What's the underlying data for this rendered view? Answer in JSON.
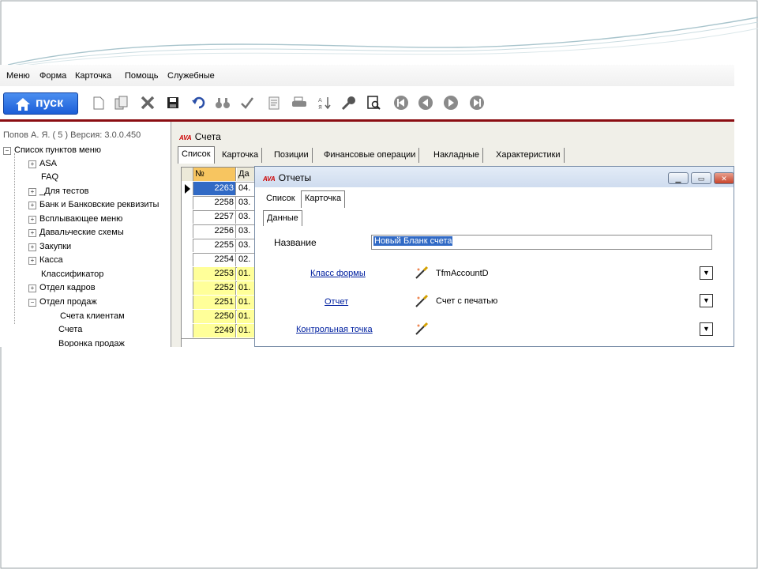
{
  "menu": [
    "Меню",
    "Форма",
    "Карточка",
    "Помощь",
    "Служебные"
  ],
  "toolbar": {
    "start_label": "пуск",
    "icons": [
      "new-doc-icon",
      "copy-doc-icon",
      "delete-icon",
      "save-icon",
      "undo-icon",
      "find-icon",
      "check-icon",
      "edit-icon",
      "print-icon",
      "sort-icon",
      "key-icon",
      "preview-icon",
      "first-record-icon",
      "prev-record-icon",
      "next-record-icon",
      "last-record-icon"
    ]
  },
  "status": {
    "user": "Попов А. Я. ( 5 )",
    "version": "Версия: 3.0.0.450"
  },
  "tree": {
    "root": "Список пунктов меню",
    "items": [
      {
        "label": "ASA",
        "expandable": true,
        "level": 1
      },
      {
        "label": "FAQ",
        "expandable": false,
        "level": 1
      },
      {
        "label": "_Для тестов",
        "expandable": true,
        "level": 1
      },
      {
        "label": "Банк и Банковские реквизиты",
        "expandable": true,
        "level": 1
      },
      {
        "label": "Всплывающее меню",
        "expandable": true,
        "level": 1
      },
      {
        "label": "Давальческие схемы",
        "expandable": true,
        "level": 1
      },
      {
        "label": "Закупки",
        "expandable": true,
        "level": 1
      },
      {
        "label": "Касса",
        "expandable": true,
        "level": 1
      },
      {
        "label": "Классификатор",
        "expandable": false,
        "level": 1
      },
      {
        "label": "Отдел кадров",
        "expandable": true,
        "level": 1
      },
      {
        "label": "Отдел продаж",
        "expandable": true,
        "level": 1,
        "expanded": true
      },
      {
        "label": "Счета клиентам",
        "expandable": false,
        "level": 2
      },
      {
        "label": "Счета",
        "expandable": false,
        "level": 2
      },
      {
        "label": "Воронка продаж",
        "expandable": false,
        "level": 2
      }
    ]
  },
  "main": {
    "title": "Счета",
    "tabs": [
      "Список",
      "Карточка",
      "Позиции",
      "Финансовые операции",
      "Накладные",
      "Характеристики"
    ],
    "grid": {
      "col_num": "№",
      "col_date": "Да",
      "rows": [
        {
          "num": "2263",
          "date": "04.",
          "state": "selected"
        },
        {
          "num": "2258",
          "date": "03.",
          "state": "normal"
        },
        {
          "num": "2257",
          "date": "03.",
          "state": "normal"
        },
        {
          "num": "2256",
          "date": "03.",
          "state": "normal"
        },
        {
          "num": "2255",
          "date": "03.",
          "state": "normal"
        },
        {
          "num": "2254",
          "date": "02.",
          "state": "normal"
        },
        {
          "num": "2253",
          "date": "01.",
          "state": "highlight"
        },
        {
          "num": "2252",
          "date": "01.",
          "state": "highlight"
        },
        {
          "num": "2251",
          "date": "01.",
          "state": "highlight"
        },
        {
          "num": "2250",
          "date": "01.",
          "state": "highlight"
        },
        {
          "num": "2249",
          "date": "01.",
          "state": "highlight"
        }
      ]
    }
  },
  "dialog": {
    "title": "Отчеты",
    "tabs": [
      "Список",
      "Карточка"
    ],
    "subtab": "Данные",
    "name_label": "Название",
    "name_value": "Новый Бланк счета",
    "fields": [
      {
        "label": "Класс формы",
        "value": "TfmAccountD"
      },
      {
        "label": "Отчет",
        "value": "Счет с печатью"
      },
      {
        "label": "Контрольная точка",
        "value": ""
      }
    ]
  },
  "colors": {
    "brand_bar": "#8b0d12",
    "selection": "#316ac5",
    "highlight_row": "#ffff99",
    "link": "#0020a0"
  }
}
